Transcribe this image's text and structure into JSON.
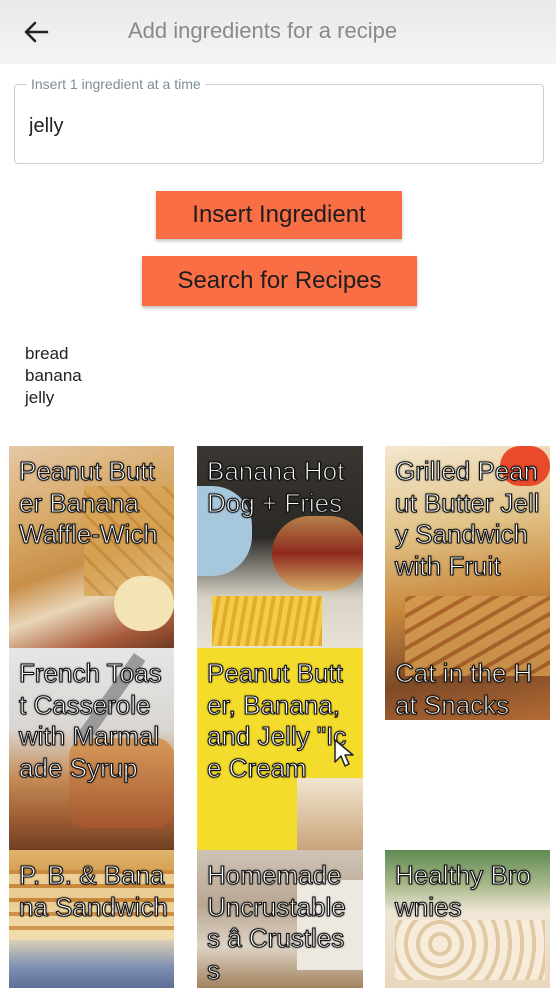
{
  "appbar": {
    "title": "Add ingredients for a recipe",
    "back_icon": "arrow-back-icon"
  },
  "ingredient_field": {
    "label": "Insert 1 ingredient at a time",
    "value": "jelly"
  },
  "buttons": {
    "insert_label": "Insert Ingredient",
    "search_label": "Search for Recipes"
  },
  "ingredients": [
    "bread",
    "banana",
    "jelly"
  ],
  "recipes": [
    {
      "title": "Peanut Butter Banana Waffle-Wich"
    },
    {
      "title": "Banana Hot Dog + Fries"
    },
    {
      "title": "Grilled Peanut Butter Jelly Sandwich with Fruit"
    },
    {
      "title": "French Toast Casserole with Marmalade Syrup"
    },
    {
      "title": "Peanut Butter, Banana, and Jelly \"Ice Cream"
    },
    {
      "title": "Cat in the Hat Snacks"
    },
    {
      "title": "P. B. & Banana Sandwich"
    },
    {
      "title": "Homemade Uncrustables â Crustless"
    },
    {
      "title": "Healthy Brownies"
    }
  ],
  "colors": {
    "button": "#fa6e45",
    "appbar": "#ececec"
  }
}
